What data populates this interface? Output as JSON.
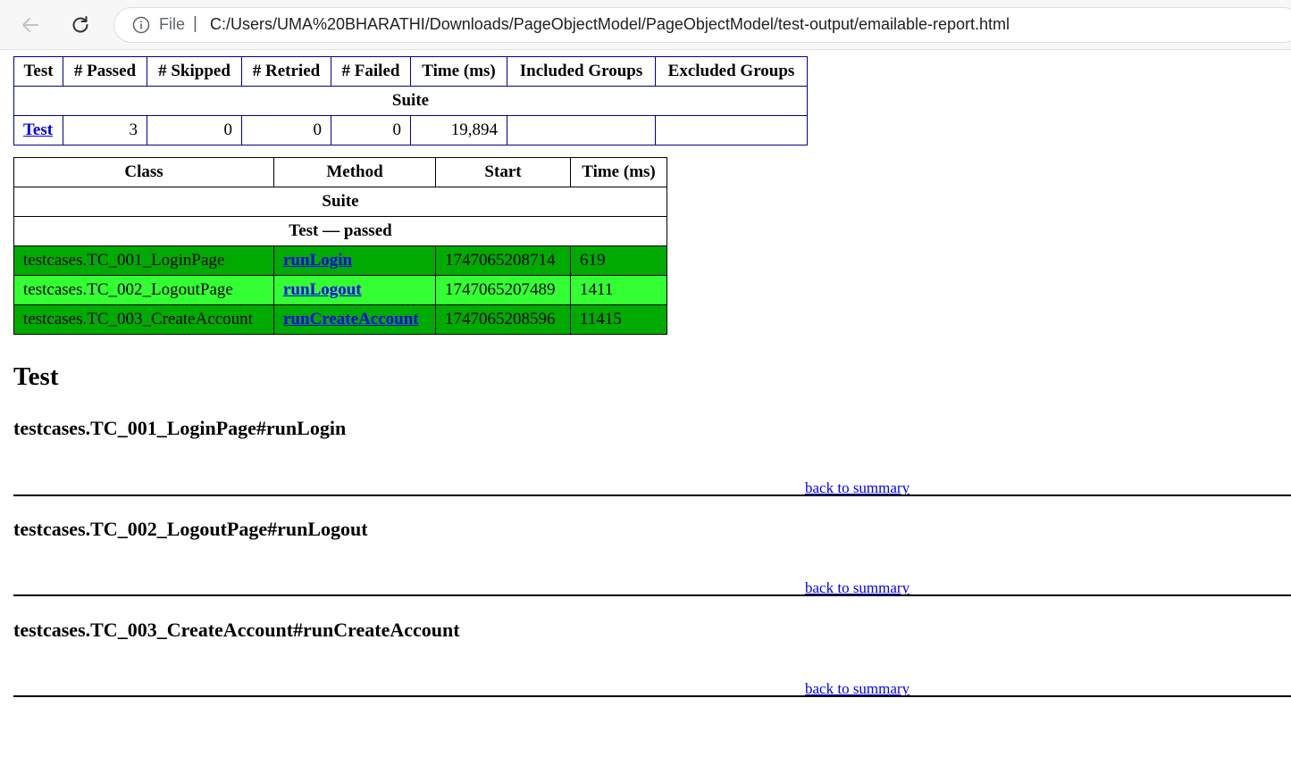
{
  "browser": {
    "scheme_label": "File",
    "separator": "|",
    "url": "C:/Users/UMA%20BHARATHI/Downloads/PageObjectModel/PageObjectModel/test-output/emailable-report.html"
  },
  "summary": {
    "headers": [
      "Test",
      "# Passed",
      "# Skipped",
      "# Retried",
      "# Failed",
      "Time (ms)",
      "Included Groups",
      "Excluded Groups"
    ],
    "suite_label": "Suite",
    "row": {
      "test": "Test",
      "passed": "3",
      "skipped": "0",
      "retried": "0",
      "failed": "0",
      "time": "19,894",
      "included": "",
      "excluded": ""
    }
  },
  "methods_table": {
    "headers": [
      "Class",
      "Method",
      "Start",
      "Time (ms)"
    ],
    "suite_label": "Suite",
    "group_label": "Test — passed",
    "rows": [
      {
        "class": "testcases.TC_001_LoginPage",
        "method": "runLogin",
        "start": "1747065208714",
        "time": "619"
      },
      {
        "class": "testcases.TC_002_LogoutPage",
        "method": "runLogout",
        "start": "1747065207489",
        "time": "1411"
      },
      {
        "class": "testcases.TC_003_CreateAccount",
        "method": "runCreateAccount",
        "start": "1747065208596",
        "time": "11415"
      }
    ],
    "colors": {
      "row_dark": "#00aa00",
      "row_light": "#33ff33"
    }
  },
  "test_section": {
    "title": "Test",
    "methods": [
      {
        "heading": "testcases.TC_001_LoginPage#runLogin",
        "back_link": "back to summary"
      },
      {
        "heading": "testcases.TC_002_LogoutPage#runLogout",
        "back_link": "back to summary"
      },
      {
        "heading": "testcases.TC_003_CreateAccount#runCreateAccount",
        "back_link": "back to summary"
      }
    ]
  }
}
